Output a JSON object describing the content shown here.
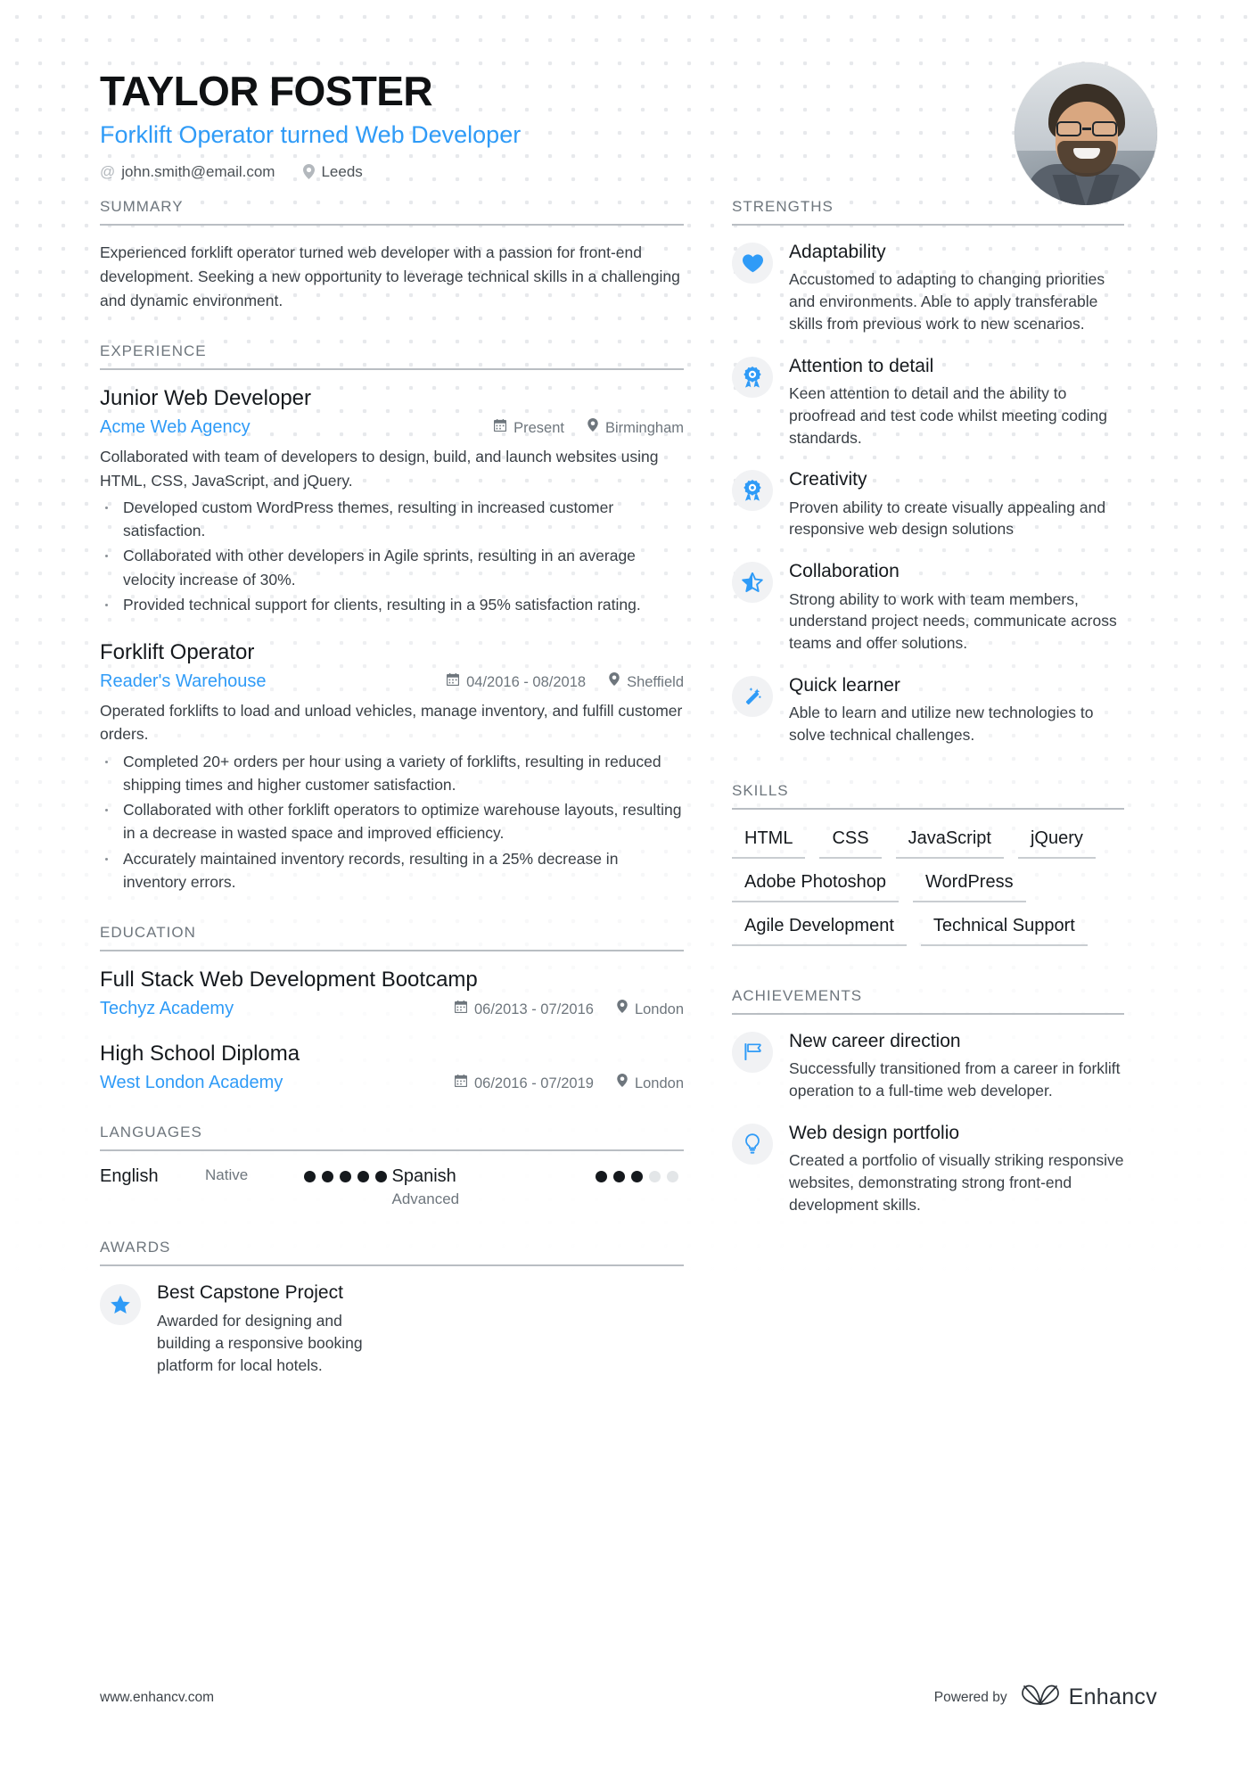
{
  "header": {
    "name": "TAYLOR FOSTER",
    "role": "Forklift Operator turned Web Developer",
    "email_icon": "at-icon",
    "email": "john.smith@email.com",
    "location_icon": "location-pin-icon",
    "location": "Leeds",
    "avatar_alt": "profile-photo"
  },
  "summary": {
    "title": "SUMMARY",
    "text": "Experienced forklift operator turned web developer with a passion for front-end development. Seeking a new opportunity to leverage technical skills in a challenging and dynamic environment."
  },
  "experience": {
    "title": "EXPERIENCE",
    "entries": [
      {
        "role": "Junior Web Developer",
        "org": "Acme Web Agency",
        "date": "Present",
        "location": "Birmingham",
        "desc": "Collaborated with team of developers to design, build, and launch websites using HTML, CSS, JavaScript, and jQuery.",
        "bullets": [
          "Developed custom WordPress themes, resulting in increased customer satisfaction.",
          "Collaborated with other developers in Agile sprints, resulting in an average velocity increase of 30%.",
          "Provided technical support for clients, resulting in a 95% satisfaction rating."
        ]
      },
      {
        "role": "Forklift Operator",
        "org": "Reader's Warehouse",
        "date": "04/2016 - 08/2018",
        "location": "Sheffield",
        "desc": "Operated forklifts to load and unload vehicles, manage inventory, and fulfill customer orders.",
        "bullets": [
          "Completed 20+ orders per hour using a variety of forklifts, resulting in reduced shipping times and higher customer satisfaction.",
          "Collaborated with other forklift operators to optimize warehouse layouts, resulting in a decrease in wasted space and improved efficiency.",
          "Accurately maintained inventory records, resulting in a 25% decrease in inventory errors."
        ]
      }
    ]
  },
  "education": {
    "title": "EDUCATION",
    "entries": [
      {
        "degree": "Full Stack Web Development Bootcamp",
        "school": "Techyz Academy",
        "date": "06/2013 - 07/2016",
        "location": "London"
      },
      {
        "degree": "High School Diploma",
        "school": "West London Academy",
        "date": "06/2016 - 07/2019",
        "location": "London"
      }
    ]
  },
  "languages": {
    "title": "LANGUAGES",
    "items": [
      {
        "name": "English",
        "level": "Native",
        "rating": 5,
        "max": 5
      },
      {
        "name": "Spanish",
        "level": "Advanced",
        "rating": 3,
        "max": 5
      }
    ]
  },
  "awards": {
    "title": "AWARDS",
    "items": [
      {
        "icon": "star-icon",
        "title": "Best Capstone Project",
        "desc": "Awarded for designing and building a responsive booking platform for local hotels."
      }
    ]
  },
  "strengths": {
    "title": "STRENGTHS",
    "items": [
      {
        "icon": "heart-icon",
        "title": "Adaptability",
        "desc": "Accustomed to adapting to changing priorities and environments. Able to apply transferable skills from previous work to new scenarios."
      },
      {
        "icon": "medal-icon",
        "title": "Attention to detail",
        "desc": "Keen attention to detail and the ability to proofread and test code whilst meeting coding standards."
      },
      {
        "icon": "medal-icon",
        "title": "Creativity",
        "desc": "Proven ability to create visually appealing and responsive web design solutions"
      },
      {
        "icon": "star-outline-icon",
        "title": "Collaboration",
        "desc": "Strong ability to work with team members, understand project needs, communicate across teams and offer solutions."
      },
      {
        "icon": "magic-wand-icon",
        "title": "Quick learner",
        "desc": "Able to learn and utilize new technologies to solve technical challenges."
      }
    ]
  },
  "skills": {
    "title": "SKILLS",
    "items": [
      "HTML",
      "CSS",
      "JavaScript",
      "jQuery",
      "Adobe Photoshop",
      "WordPress",
      "Agile Development",
      "Technical Support"
    ]
  },
  "achievements": {
    "title": "ACHIEVEMENTS",
    "items": [
      {
        "icon": "flag-icon",
        "title": "New career direction",
        "desc": "Successfully transitioned from a career in forklift operation to a full-time web developer."
      },
      {
        "icon": "lightbulb-icon",
        "title": "Web design portfolio",
        "desc": "Created a portfolio of visually striking responsive websites, demonstrating strong front-end development skills."
      }
    ]
  },
  "footer": {
    "url": "www.enhancv.com",
    "powered_by": "Powered by",
    "brand": "Enhancv",
    "brand_icon": "enhancv-logo-icon"
  },
  "colors": {
    "accent": "#2f9bf7",
    "heading": "#6e767d",
    "text": "#393f45",
    "rule": "#b9bec3"
  }
}
